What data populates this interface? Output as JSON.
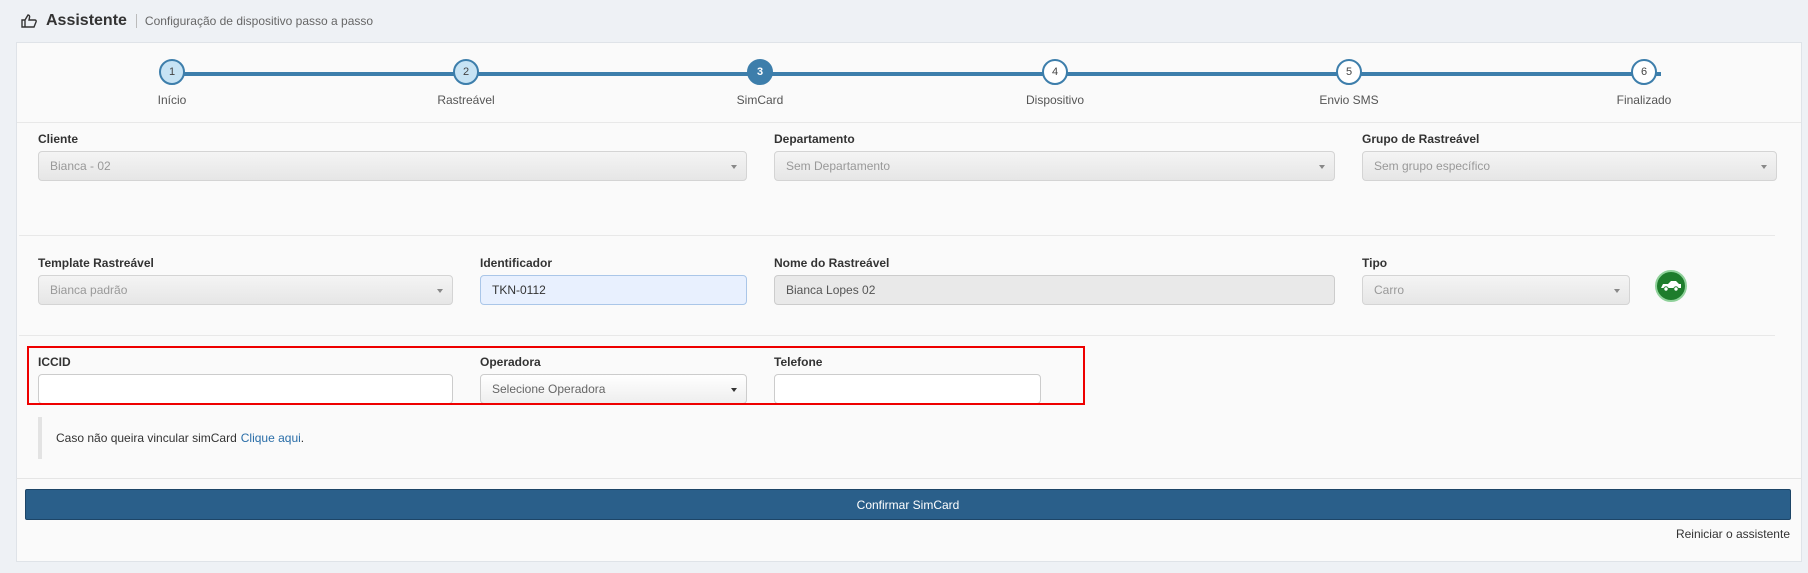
{
  "header": {
    "title": "Assistente",
    "subtitle": "Configuração de dispositivo passo a passo",
    "icon": "hand-pointer-icon"
  },
  "steps": [
    {
      "number": "1",
      "label": "Início",
      "state": "done"
    },
    {
      "number": "2",
      "label": "Rastreável",
      "state": "done"
    },
    {
      "number": "3",
      "label": "SimCard",
      "state": "active"
    },
    {
      "number": "4",
      "label": "Dispositivo",
      "state": "pending"
    },
    {
      "number": "5",
      "label": "Envio SMS",
      "state": "pending"
    },
    {
      "number": "6",
      "label": "Finalizado",
      "state": "pending"
    }
  ],
  "row1": {
    "cliente": {
      "label": "Cliente",
      "value": "Bianca - 02"
    },
    "departamento": {
      "label": "Departamento",
      "value": "Sem Departamento"
    },
    "grupo": {
      "label": "Grupo de Rastreável",
      "value": "Sem grupo específico"
    }
  },
  "row2": {
    "template": {
      "label": "Template Rastreável",
      "value": "Bianca padrão"
    },
    "identificador": {
      "label": "Identificador",
      "value": "TKN-0112"
    },
    "nome": {
      "label": "Nome do Rastreável",
      "value": "Bianca Lopes 02"
    },
    "tipo": {
      "label": "Tipo",
      "value": "Carro",
      "icon": "car-icon"
    }
  },
  "simcard": {
    "iccid": {
      "label": "ICCID",
      "value": ""
    },
    "operadora": {
      "label": "Operadora",
      "value": "Selecione Operadora"
    },
    "telefone": {
      "label": "Telefone",
      "value": ""
    }
  },
  "note": {
    "text": "Caso não queira vincular simCard",
    "link": "Clique aqui",
    "suffix": "."
  },
  "actions": {
    "confirm": "Confirmar SimCard",
    "restart": "Reiniciar o assistente"
  },
  "colors": {
    "accent": "#3d7eab",
    "primary_button": "#2a5f8a",
    "highlight": "#e00000",
    "car_icon_bg": "#1e7d2c"
  }
}
